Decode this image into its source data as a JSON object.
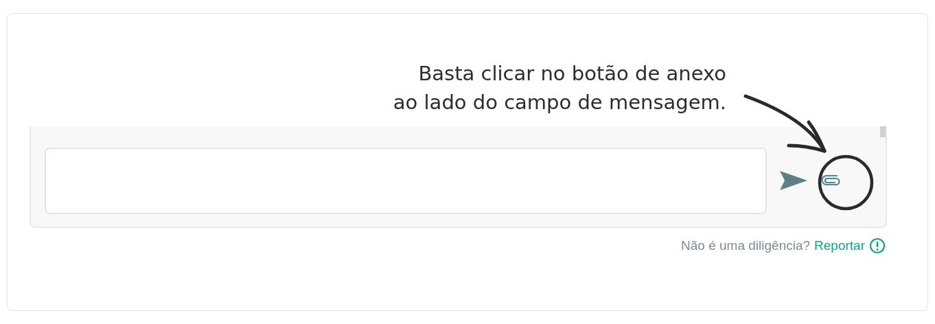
{
  "callout": {
    "lines": [
      "Basta clicar no botão de anexo",
      "ao lado do campo de mensagem."
    ]
  },
  "footer": {
    "question": "Não é uma diligência?",
    "link": "Reportar"
  }
}
